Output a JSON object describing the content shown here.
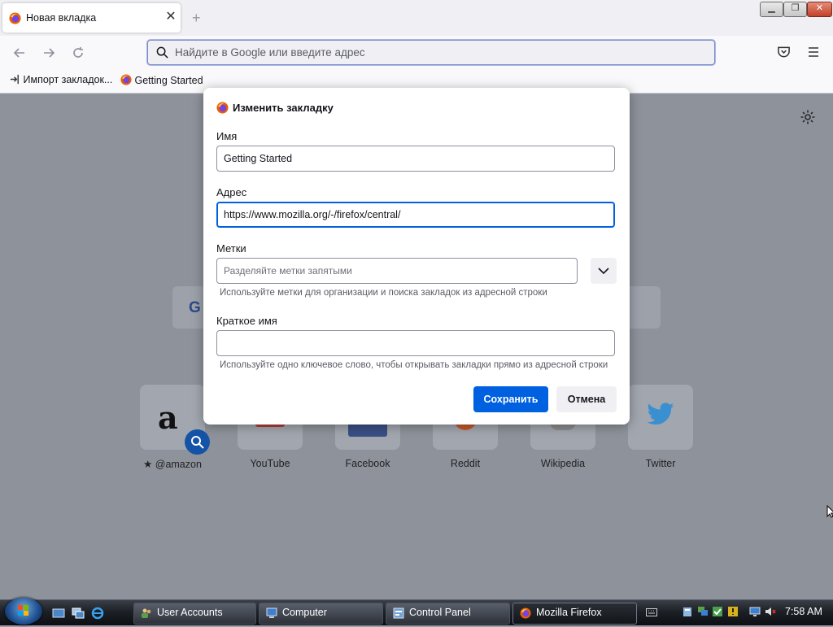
{
  "browser": {
    "tab_title": "Новая вкладка",
    "tab_close": "✕",
    "new_tab": "+",
    "search_placeholder": "Найдите в Google или введите адрес",
    "bookmarks": [
      "Импорт закладок...",
      "Getting Started"
    ]
  },
  "window_buttons": {
    "minimize": "▁",
    "maximize": "❐",
    "close": "✕"
  },
  "newtab": {
    "sites": [
      {
        "label": "@amazon"
      },
      {
        "label": "YouTube"
      },
      {
        "label": "Facebook"
      },
      {
        "label": "Reddit"
      },
      {
        "label": "Wikipedia"
      },
      {
        "label": "Twitter"
      }
    ],
    "search_logo": "G"
  },
  "dialog": {
    "title": "Изменить закладку",
    "name_label": "Имя",
    "name_value": "Getting Started",
    "url_label": "Адрес",
    "url_value": "https://www.mozilla.org/-/firefox/central/",
    "tags_label": "Метки",
    "tags_placeholder": "Разделяйте метки запятыми",
    "tags_hint": "Используйте метки для организации и поиска закладок из адресной строки",
    "keyword_label": "Краткое имя",
    "keyword_value": "",
    "keyword_hint": "Используйте одно ключевое слово, чтобы открывать закладки прямо из адресной строки",
    "save_button": "Сохранить",
    "cancel_button": "Отмена"
  },
  "taskbar": {
    "buttons": [
      "User Accounts",
      "Computer",
      "Control Panel",
      "Mozilla Firefox"
    ],
    "clock": "7:58 AM"
  },
  "colors": {
    "accent": "#0061e0",
    "overlay": "#8e929b",
    "taskbar": "#1d2127"
  }
}
